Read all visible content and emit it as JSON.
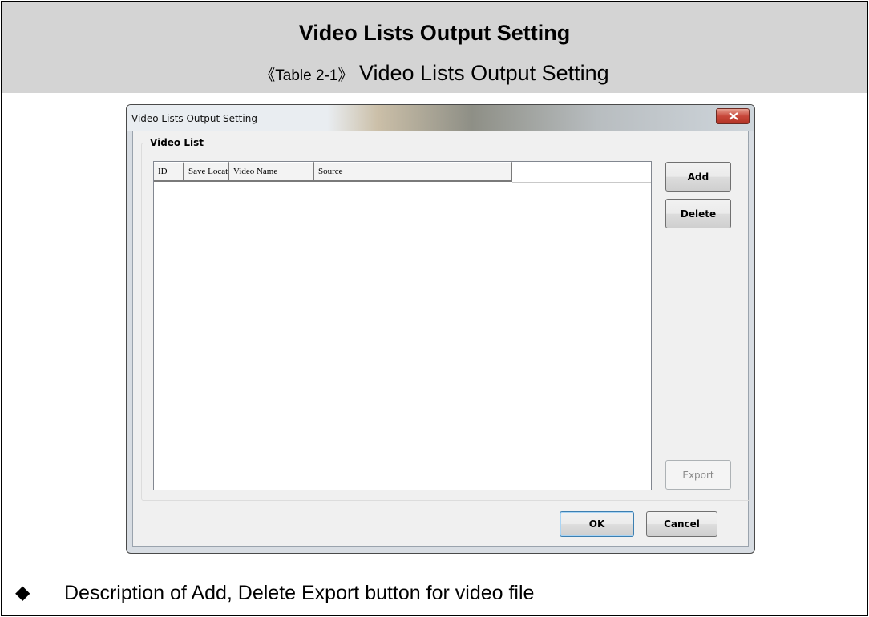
{
  "header": {
    "title": "Video Lists Output Setting",
    "subtitle_prefix": "《Table 2-1》",
    "subtitle_text": "Video Lists Output Setting"
  },
  "dialog": {
    "title": "Video Lists Output Setting",
    "group_label": "Video List",
    "columns": [
      "ID",
      "Save Locat",
      "Video Name",
      "Source"
    ],
    "buttons": {
      "add": "Add",
      "delete": "Delete",
      "export": "Export",
      "ok": "OK",
      "cancel": "Cancel"
    },
    "icons": {
      "close": "close-icon"
    }
  },
  "description": {
    "bullet_icon": "diamond-bullet-icon",
    "text": "Description of Add, Delete Export button for video file"
  }
}
